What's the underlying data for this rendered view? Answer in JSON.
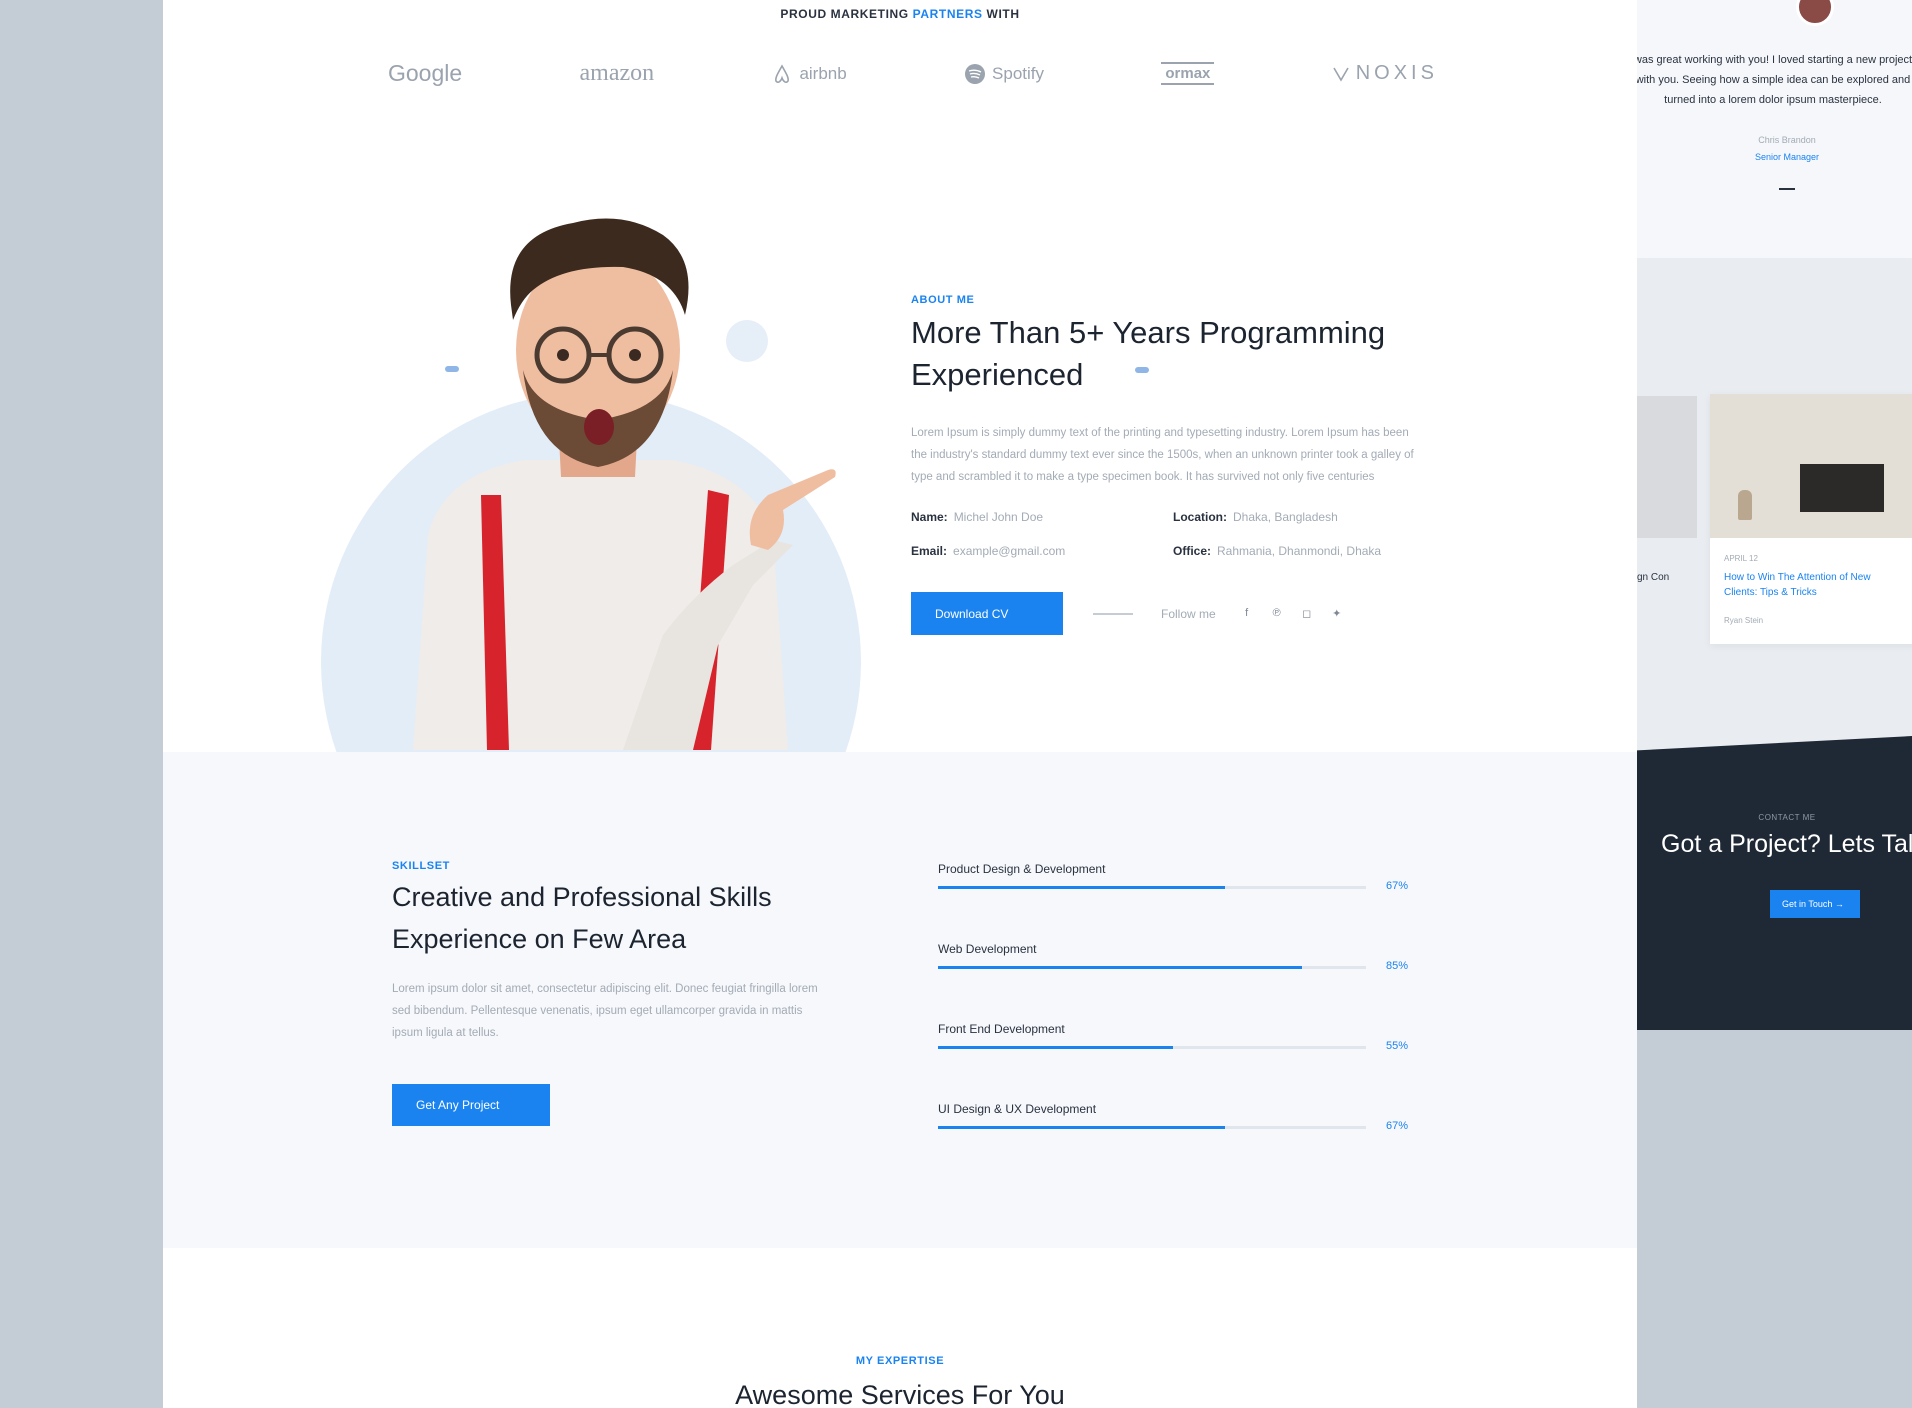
{
  "partners": {
    "title_prefix": "PROUD MARKETING",
    "title_accent": "PARTNERS",
    "title_suffix": "WITH",
    "logos": [
      "Google",
      "amazon",
      "airbnb",
      "Spotify",
      "ormax",
      "NOXIS"
    ]
  },
  "about": {
    "eyebrow": "ABOUT ME",
    "title": "More Than 5+ Years Programming Experienced",
    "description": "Lorem Ipsum is simply dummy text of the printing and typesetting industry. Lorem Ipsum has been the industry's standard dummy text ever since the 1500s, when an unknown printer took a galley of type and scrambled it to make a type specimen book. It has survived not only five centuries",
    "info": [
      {
        "label": "Name:",
        "value": "Michel John Doe"
      },
      {
        "label": "Location:",
        "value": "Dhaka, Bangladesh"
      },
      {
        "label": "Email:",
        "value": "example@gmail.com"
      },
      {
        "label": "Office:",
        "value": "Rahmania, Dhanmondi, Dhaka"
      }
    ],
    "download_label": "Download CV",
    "follow_label": "Follow me",
    "social_icons": [
      "facebook-icon",
      "pinterest-icon",
      "instagram-icon",
      "twitter-icon"
    ]
  },
  "skills": {
    "eyebrow": "SKILLSET",
    "title": "Creative and Professional Skills Experience on Few Area",
    "description": "Lorem ipsum dolor sit amet, consectetur adipiscing elit. Donec feugiat fringilla lorem sed bibendum. Pellentesque venenatis, ipsum eget ullamcorper gravida in mattis ipsum ligula at tellus.",
    "button_label": "Get Any Project",
    "items": [
      {
        "label": "Product Design & Development",
        "percent": 67,
        "percent_label": "67%"
      },
      {
        "label": "Web Development",
        "percent": 85,
        "percent_label": "85%"
      },
      {
        "label": "Front End Development",
        "percent": 55,
        "percent_label": "55%"
      },
      {
        "label": "UI Design & UX Development",
        "percent": 67,
        "percent_label": "67%"
      }
    ]
  },
  "services": {
    "eyebrow": "MY EXPERTISE",
    "title": "Awesome Services For You"
  },
  "side": {
    "testimonial": "was great working with you! I loved starting a new project with you. Seeing how a simple idea can be explored and turned into a lorem dolor ipsum masterpiece.",
    "testimonial_name": "Chris Brandon",
    "testimonial_role": "Senior Manager",
    "blog_snip": "gn Con",
    "blog_date": "APRIL 12",
    "blog_title": "How to Win The Attention of New Clients: Tips & Tricks",
    "blog_author": "Ryan Stein",
    "contact_eyebrow": "CONTACT ME",
    "contact_title": "Got a Project? Lets Talk",
    "contact_button": "Get in Touch →"
  },
  "colors": {
    "accent": "#1a83f0",
    "dark": "#1f2835",
    "backdrop": "#c4ccd5"
  }
}
